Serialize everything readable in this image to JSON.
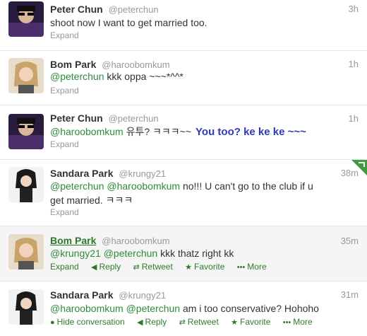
{
  "tweets": [
    {
      "name": "Peter Chun",
      "handle": "@peterchun",
      "time": "3h",
      "text": "shoot now I want to get married too.",
      "expand": "Expand"
    },
    {
      "name": "Bom Park",
      "handle": "@haroobomkum",
      "time": "1h",
      "mention1": "@peterchun",
      "text": " kkk oppa ~~~*^^*",
      "expand": "Expand"
    },
    {
      "name": "Peter Chun",
      "handle": "@peterchun",
      "time": "1h",
      "mention1": "@haroobomkum",
      "text": " 유투? ㅋㅋㅋ~~",
      "annotation": "You too? ke ke ke ~~~",
      "expand": "Expand"
    },
    {
      "name": "Sandara Park",
      "handle": "@krungy21",
      "time": "38m",
      "mention1": "@peterchun",
      "mention2": "@haroobomkum",
      "text": " no!!! U can't go to the club if u get married. ㅋㅋㅋ",
      "expand": "Expand"
    },
    {
      "name": "Bom Park",
      "handle": "@haroobomkum",
      "time": "35m",
      "mention1": "@krungy21",
      "mention2": "@peterchun",
      "text": " kkk thatz right kk",
      "expand": "Expand",
      "reply": "Reply",
      "retweet": "Retweet",
      "favorite": "Favorite",
      "more": "More"
    },
    {
      "name": "Sandara Park",
      "handle": "@krungy21",
      "time": "31m",
      "mention1": "@haroobomkum",
      "mention2": "@peterchun",
      "text": " am i too conservative? Hohoho",
      "hide": "Hide conversation",
      "reply": "Reply",
      "retweet": "Retweet",
      "favorite": "Favorite",
      "more": "More"
    }
  ],
  "icons": {
    "reply": "reply-icon",
    "retweet": "retweet-icon",
    "favorite": "star-icon",
    "more": "more-icon",
    "conversation": "conversation-icon",
    "corner": "retweet-corner-icon"
  },
  "colors": {
    "mention": "#2f8a3a",
    "annotation": "#2d3ab8",
    "corner": "#3f9b3f"
  }
}
